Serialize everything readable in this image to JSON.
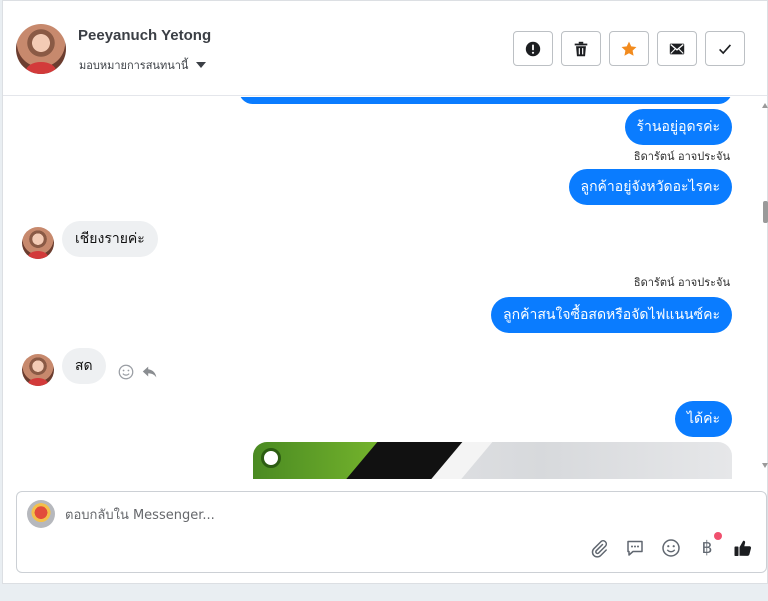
{
  "header": {
    "contact_name": "Peeyanuch Yetong",
    "assign_label": "มอบหมายการสนทนานี้",
    "actions": [
      {
        "name": "report-spam",
        "icon": "exclamation-circle-icon"
      },
      {
        "name": "delete",
        "icon": "trash-icon"
      },
      {
        "name": "star",
        "icon": "star-icon"
      },
      {
        "name": "mark-unread",
        "icon": "envelope-icon"
      },
      {
        "name": "mark-done",
        "icon": "check-icon"
      }
    ]
  },
  "messages": {
    "m1_out": "ร้านอยู่อุดรค่ะ",
    "m2_sender": "ธิดารัตน์ อาจประจัน",
    "m2_out": "ลูกค้าอยู่จังหวัดอะไรคะ",
    "m3_in": "เชียงรายค่ะ",
    "m4_sender": "ธิดารัตน์ อาจประจัน",
    "m4_out": "ลูกค้าสนใจซื้อสดหรือจัดไฟแนนซ์คะ",
    "m5_in": "สด",
    "m6_out": "ได้ค่ะ"
  },
  "composer": {
    "placeholder": "ตอบกลับใน Messenger...",
    "baht_symbol": "฿"
  },
  "colors": {
    "outgoing_bubble": "#0a7cff",
    "incoming_bubble": "#eef0f2",
    "star": "#f28b1e",
    "notification_dot": "#f0506e"
  }
}
